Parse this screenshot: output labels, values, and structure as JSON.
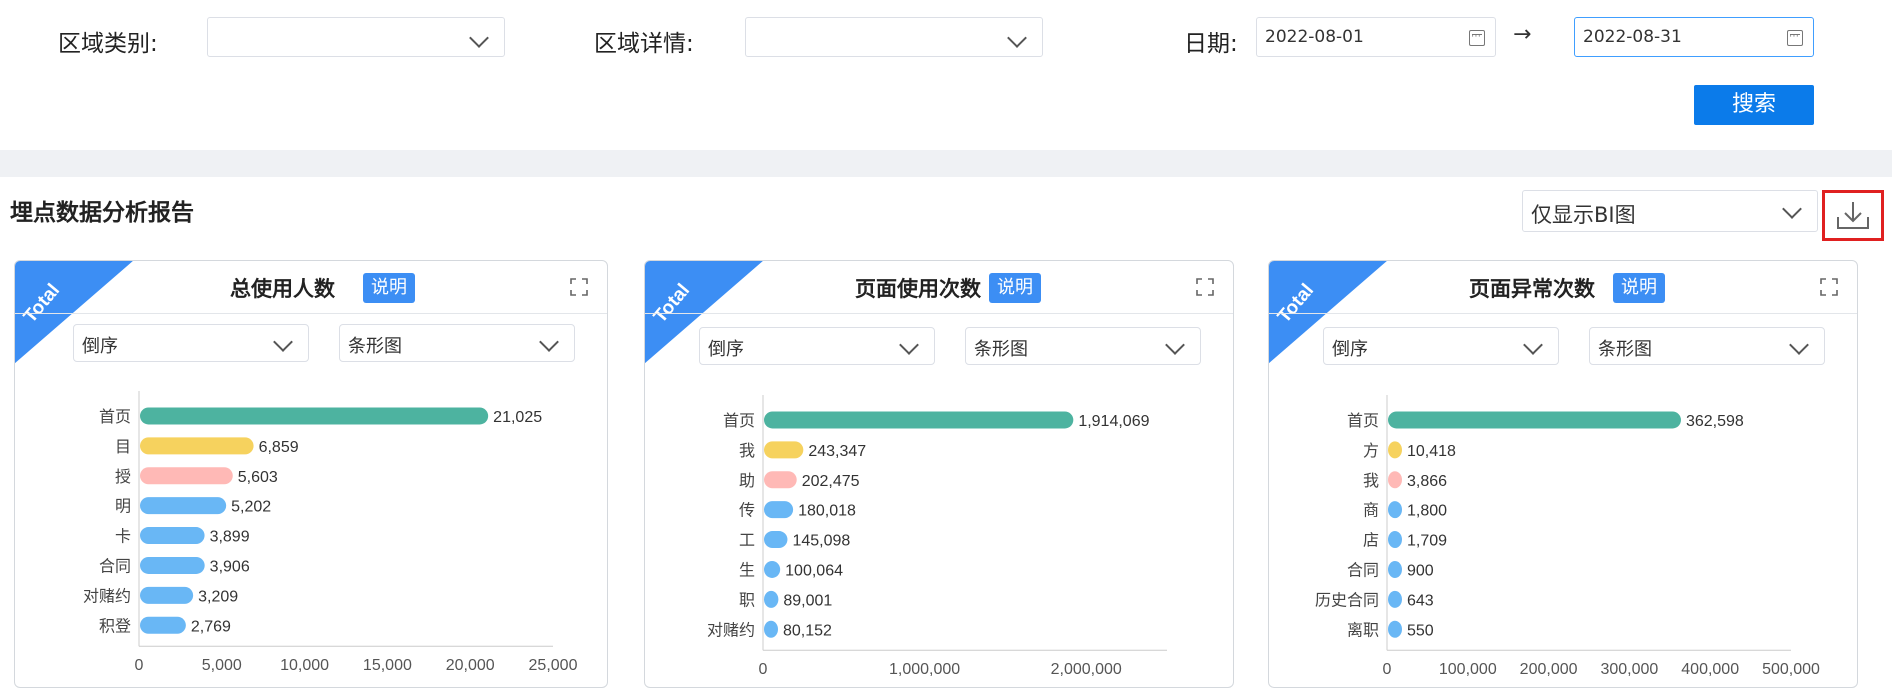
{
  "filters": {
    "area_type_label": "区域类别:",
    "area_detail_label": "区域详情:",
    "date_label": "日期:",
    "date_start": "2022-08-01",
    "date_end": "2022-08-31",
    "arrow": "→",
    "search_label": "搜索"
  },
  "report": {
    "title": "埋点数据分析报告",
    "mode_select": "仅显示BI图"
  },
  "cards": [
    {
      "title": "总使用人数",
      "help": "说明",
      "ribbon": "Total",
      "sort": "倒序",
      "chart_type": "条形图"
    },
    {
      "title": "页面使用次数",
      "help": "说明",
      "ribbon": "Total",
      "sort": "倒序",
      "chart_type": "条形图"
    },
    {
      "title": "页面异常次数",
      "help": "说明",
      "ribbon": "Total",
      "sort": "倒序",
      "chart_type": "条形图"
    }
  ],
  "colors": {
    "teal": "#4db3a0",
    "yellow": "#f6d25e",
    "pink": "#ffb9b6",
    "blue": "#69b7f5",
    "primary": "#0b7bea",
    "badge": "#3c8ef4",
    "highlight": "#e02020"
  },
  "chart_data": [
    {
      "type": "bar",
      "orientation": "horizontal",
      "title": "总使用人数",
      "categories": [
        "首页",
        "目",
        "授",
        "明",
        "卡",
        "合同",
        "对赌约",
        "积登"
      ],
      "values": [
        21025,
        6859,
        5603,
        5202,
        3899,
        3906,
        3209,
        2769
      ],
      "value_labels": [
        "21,025",
        "6,859",
        "5,603",
        "5,202",
        "3,899",
        "3,906",
        "3,209",
        "2,769"
      ],
      "xticks": [
        "0",
        "5,000",
        "10,000",
        "15,000",
        "20,000",
        "25,000"
      ],
      "xlim": [
        0,
        25000
      ]
    },
    {
      "type": "bar",
      "orientation": "horizontal",
      "title": "页面使用次数",
      "categories": [
        "首页",
        "我",
        "助",
        "传",
        "工",
        "生",
        "职",
        "对赌约"
      ],
      "values": [
        1914069,
        243347,
        202475,
        180018,
        145098,
        100064,
        89001,
        80152
      ],
      "value_labels": [
        "1,914,069",
        "243,347",
        "202,475",
        "180,018",
        "145,098",
        "100,064",
        "89,001",
        "80,152"
      ],
      "xticks": [
        "0",
        "1,000,000",
        "2,000,000"
      ],
      "xlim": [
        0,
        2500000
      ]
    },
    {
      "type": "bar",
      "orientation": "horizontal",
      "title": "页面异常次数",
      "categories": [
        "首页",
        "方",
        "我",
        "商",
        "店",
        "合同",
        "历史合同",
        "离职"
      ],
      "values": [
        362598,
        10418,
        3866,
        1800,
        1709,
        900,
        643,
        550
      ],
      "value_labels": [
        "362,598",
        "10,418",
        "3,866",
        "1,800",
        "1,709",
        "900",
        "643",
        "550"
      ],
      "xticks": [
        "0",
        "100,000",
        "200,000",
        "300,000",
        "400,000",
        "500,000"
      ],
      "xlim": [
        0,
        500000
      ]
    }
  ]
}
